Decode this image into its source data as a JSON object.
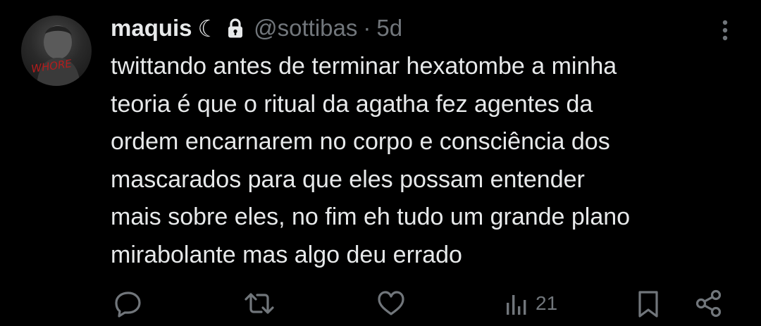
{
  "tweet": {
    "author": {
      "display_name": "maquis",
      "emoji": "☾",
      "handle": "@sottibas",
      "avatar_text": "WHORE"
    },
    "separator": "·",
    "time": "5d",
    "text_lines": [
      "twittando antes de terminar hexatombe a minha",
      "teoria é que o ritual da agatha fez agentes da",
      "ordem encarnarem no corpo e consciência dos",
      "mascarados para que eles possam entender",
      "mais sobre eles, no fim eh tudo um grande plano",
      "mirabolante mas algo deu errado"
    ],
    "stats": {
      "views": "21"
    }
  },
  "icons": {
    "lock": "lock-icon",
    "more": "more-icon",
    "reply": "reply-icon",
    "retweet": "retweet-icon",
    "like": "like-icon",
    "views": "views-icon",
    "bookmark": "bookmark-icon",
    "share": "share-icon"
  },
  "colors": {
    "background": "#000000",
    "primary_text": "#e7e9ea",
    "secondary_text": "#71767b",
    "avatar_text": "#b31d1d"
  }
}
